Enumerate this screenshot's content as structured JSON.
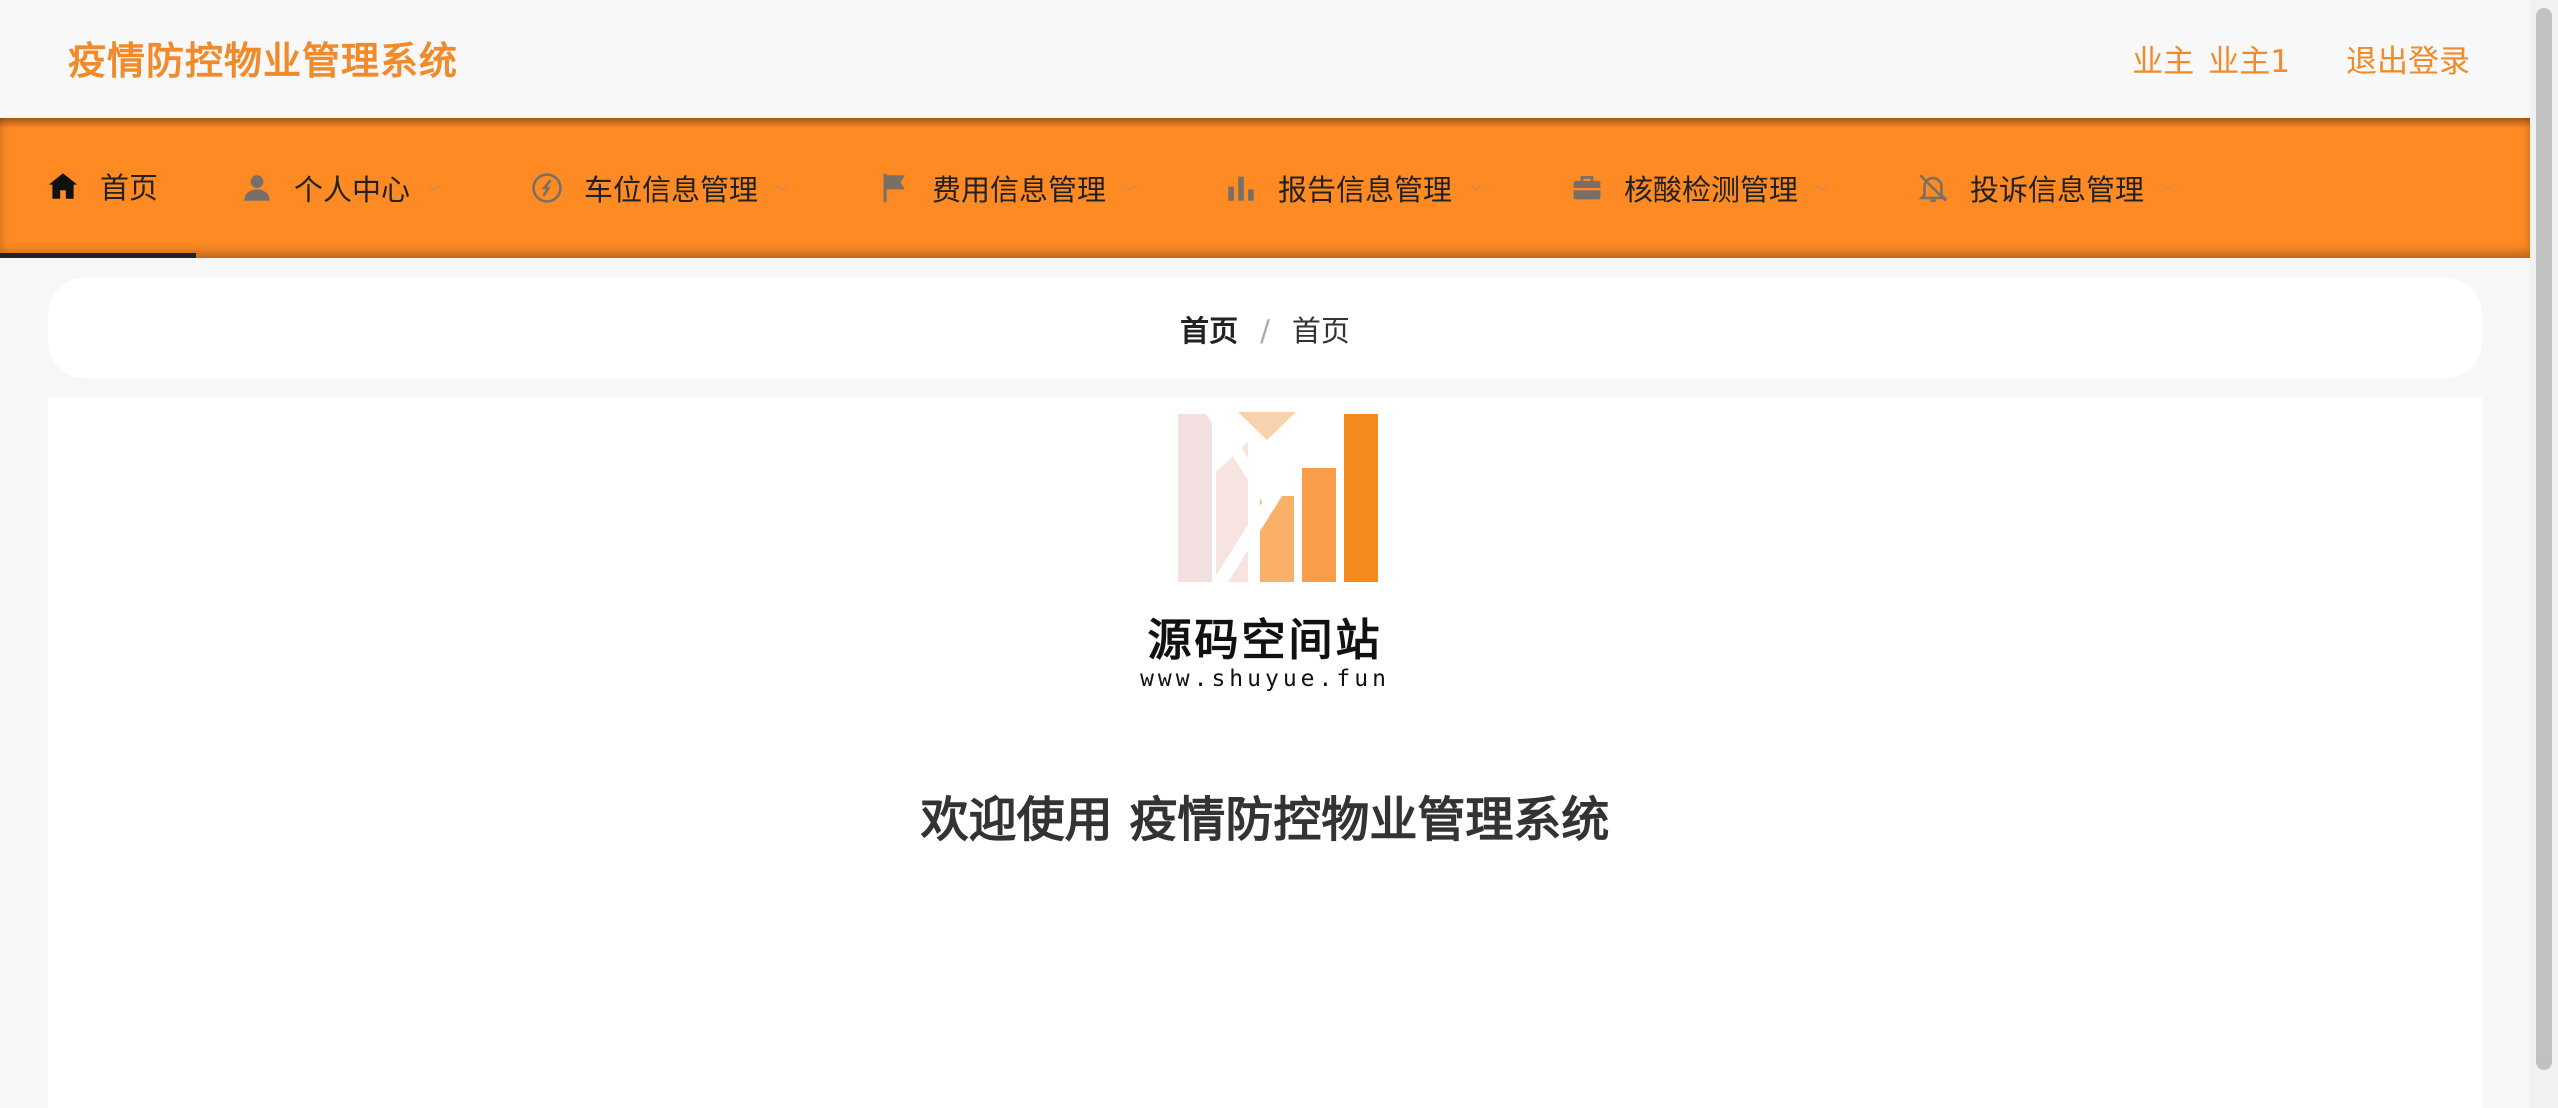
{
  "header": {
    "title": "疫情防控物业管理系统",
    "user_role": "业主",
    "user_name": "业主1",
    "logout_label": "退出登录"
  },
  "nav": {
    "items": [
      {
        "label": "首页",
        "icon": "home-icon"
      },
      {
        "label": "个人中心",
        "icon": "user-icon"
      },
      {
        "label": "车位信息管理",
        "icon": "compass-icon"
      },
      {
        "label": "费用信息管理",
        "icon": "flag-icon"
      },
      {
        "label": "报告信息管理",
        "icon": "bar-chart-icon"
      },
      {
        "label": "核酸检测管理",
        "icon": "briefcase-icon"
      },
      {
        "label": "投诉信息管理",
        "icon": "bell-off-icon"
      }
    ]
  },
  "breadcrumb": {
    "first": "首页",
    "second": "首页"
  },
  "logo": {
    "title": "源码空间站",
    "url": "www.shuyue.fun"
  },
  "welcome": "欢迎使用 疫情防控物业管理系统",
  "colors": {
    "accent": "#fe8a24",
    "accent_text": "#f08a2a",
    "nav_text": "#222222"
  }
}
